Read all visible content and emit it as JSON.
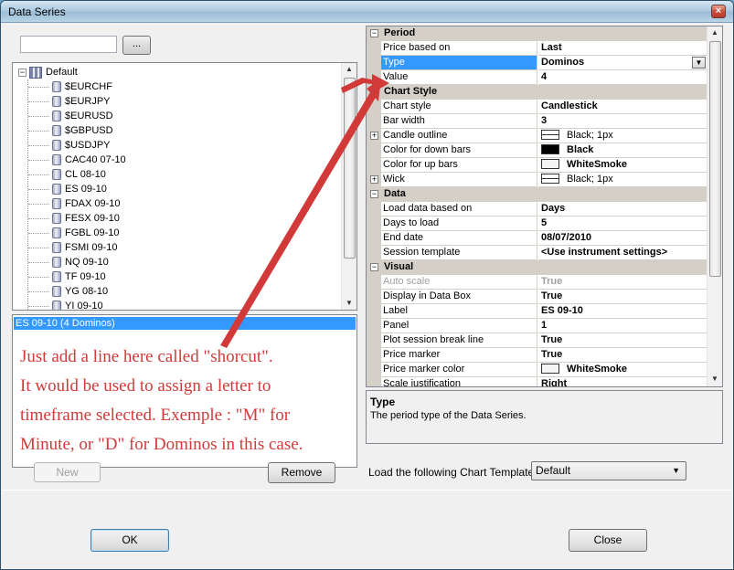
{
  "window": {
    "title": "Data Series",
    "close_glyph": "×"
  },
  "left": {
    "search": {
      "value": "",
      "browse_label": "..."
    },
    "tree": {
      "root": "Default",
      "items": [
        "$EURCHF",
        "$EURJPY",
        "$EURUSD",
        "$GBPUSD",
        "$USDJPY",
        "CAC40 07-10",
        "CL 08-10",
        "ES 09-10",
        "FDAX 09-10",
        "FESX 09-10",
        "FGBL 09-10",
        "FSMI 09-10",
        "NQ 09-10",
        "TF 09-10",
        "YG 08-10",
        "YI 09-10"
      ]
    },
    "selected_series": "ES 09-10 (4 Dominos)",
    "annotation": [
      "Just add a line here called \"shorcut\".",
      "It would be used to assign a letter to",
      "timeframe selected. Exemple : \"M\" for",
      "Minute, or \"D\" for Dominos in this case."
    ],
    "new_label": "New",
    "remove_label": "Remove"
  },
  "grid": {
    "rows": [
      {
        "kind": "cat",
        "label": "Period"
      },
      {
        "kind": "prop",
        "name": "Price based on",
        "value": "Last"
      },
      {
        "kind": "prop",
        "name": "Type",
        "value": "Dominos",
        "selected": true,
        "dropdown": true
      },
      {
        "kind": "prop",
        "name": "Value",
        "value": "4"
      },
      {
        "kind": "cat",
        "label": "Chart Style"
      },
      {
        "kind": "prop",
        "name": "Chart style",
        "value": "Candlestick"
      },
      {
        "kind": "prop",
        "name": "Bar width",
        "value": "3"
      },
      {
        "kind": "prop",
        "name": "Candle outline",
        "value": "Black; 1px",
        "swatch": "line",
        "expander": true,
        "normal": true
      },
      {
        "kind": "prop",
        "name": "Color for down bars",
        "value": "Black",
        "swatch": "#000000"
      },
      {
        "kind": "prop",
        "name": "Color for up bars",
        "value": "WhiteSmoke",
        "swatch": "#f5f5f5"
      },
      {
        "kind": "prop",
        "name": "Wick",
        "value": "Black; 1px",
        "swatch": "line",
        "expander": true,
        "normal": true
      },
      {
        "kind": "cat",
        "label": "Data"
      },
      {
        "kind": "prop",
        "name": "Load data based on",
        "value": "Days"
      },
      {
        "kind": "prop",
        "name": "Days to load",
        "value": "5"
      },
      {
        "kind": "prop",
        "name": "End date",
        "value": "08/07/2010"
      },
      {
        "kind": "prop",
        "name": "Session template",
        "value": "<Use instrument settings>"
      },
      {
        "kind": "cat",
        "label": "Visual"
      },
      {
        "kind": "prop",
        "name": "Auto scale",
        "value": "True",
        "disabled": true
      },
      {
        "kind": "prop",
        "name": "Display in Data Box",
        "value": "True"
      },
      {
        "kind": "prop",
        "name": "Label",
        "value": "ES 09-10"
      },
      {
        "kind": "prop",
        "name": "Panel",
        "value": "1"
      },
      {
        "kind": "prop",
        "name": "Plot session break line",
        "value": "True"
      },
      {
        "kind": "prop",
        "name": "Price marker",
        "value": "True"
      },
      {
        "kind": "prop",
        "name": "Price marker color",
        "value": "WhiteSmoke",
        "swatch": "#f5f5f5"
      },
      {
        "kind": "prop",
        "name": "Scale justification",
        "value": "Right"
      }
    ],
    "expander_glyph": "−",
    "sub_expander_glyph": "+"
  },
  "help": {
    "title": "Type",
    "description": "The period type of the Data Series."
  },
  "template": {
    "label": "Load the following Chart Template:",
    "value": "Default"
  },
  "buttons": {
    "ok": "OK",
    "close": "Close"
  },
  "colors": {
    "annotation": "#d23a3a",
    "selection": "#3399ff",
    "category": "#d4d0c8"
  }
}
